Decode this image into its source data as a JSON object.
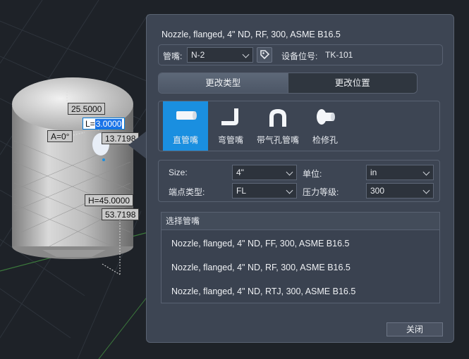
{
  "viewport": {
    "dimensions": {
      "height_top": "25.5000",
      "length": "3.0000",
      "offset_x": "13.7198",
      "angle": "A=0°",
      "height": "H=45.0000",
      "height_total": "53.7198"
    }
  },
  "panel": {
    "title": "Nozzle, flanged, 4\" ND, RF, 300, ASME B16.5",
    "nozzle_label": "管嘴:",
    "nozzle_value": "N-2",
    "equipment_label": "设备位号:",
    "equipment_value": "TK-101",
    "tabs": [
      {
        "label": "更改类型",
        "active": true
      },
      {
        "label": "更改位置",
        "active": false
      }
    ],
    "types": [
      {
        "label": "直管嘴",
        "icon": "straight-nozzle-icon",
        "selected": true
      },
      {
        "label": "弯管嘴",
        "icon": "elbow-nozzle-icon",
        "selected": false
      },
      {
        "label": "带气孔管嘴",
        "icon": "vent-nozzle-icon",
        "selected": false
      },
      {
        "label": "检修孔",
        "icon": "manhole-icon",
        "selected": false
      }
    ],
    "props": {
      "size_label": "Size:",
      "size_value": "4\"",
      "unit_label": "单位:",
      "unit_value": "in",
      "end_type_label": "端点类型:",
      "end_type_value": "FL",
      "pressure_label": "压力等级:",
      "pressure_value": "300"
    },
    "list": {
      "header": "选择管嘴",
      "items": [
        "Nozzle, flanged, 4\" ND, FF, 300, ASME B16.5",
        "Nozzle, flanged, 4\" ND, RF, 300, ASME B16.5",
        "Nozzle, flanged, 4\" ND, RTJ, 300, ASME B16.5"
      ]
    },
    "close_label": "关闭"
  },
  "colors": {
    "panel_bg": "#3d4553",
    "accent": "#1a8fe0",
    "grid": "#3c7a3c"
  }
}
